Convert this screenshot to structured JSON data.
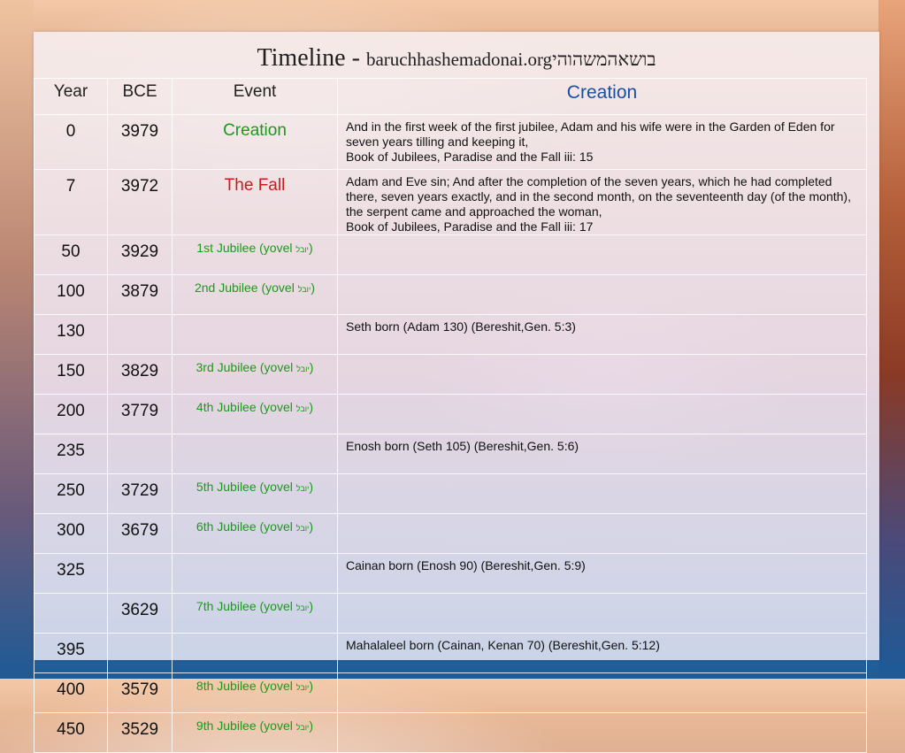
{
  "title": {
    "main": "Timeline - ",
    "site": "baruchhashemadonai.org",
    "hebrew": "בושאהמשהוהי"
  },
  "headers": {
    "year": "Year",
    "bce": "BCE",
    "event": "Event",
    "creation": "Creation"
  },
  "rows": [
    {
      "year": "0",
      "bce": "3979",
      "event": "Creation",
      "note": "And in the first week of the first jubilee, Adam and his wife were in the Garden of Eden for seven years tilling and keeping it,\nBook of Jubilees, Paradise and the Fall iii: 15"
    },
    {
      "year": "7",
      "bce": "3972",
      "event": "The Fall",
      "note": "Adam and Eve sin; And after the completion of the seven years, which he had completed there, seven years exactly, and in the second month, on the seventeenth day (of the month), the serpent came and approached the woman,\nBook of Jubilees, Paradise and the Fall iii: 17"
    },
    {
      "year": "50",
      "bce": "3929",
      "event": "1st Jubilee (yovel ",
      "heb": "יובל",
      "event_end": ")",
      "note": ""
    },
    {
      "year": "100",
      "bce": "3879",
      "event": "2nd Jubilee (yovel ",
      "heb": "יובל",
      "event_end": ")",
      "note": ""
    },
    {
      "year": "130",
      "bce": "",
      "event": "",
      "note": "Seth born (Adam 130) (Bereshit,Gen. 5:3)"
    },
    {
      "year": "150",
      "bce": "3829",
      "event": "3rd Jubilee (yovel ",
      "heb": "יובל",
      "event_end": ")",
      "note": ""
    },
    {
      "year": "200",
      "bce": "3779",
      "event": "4th Jubilee (yovel ",
      "heb": "יובל",
      "event_end": ")",
      "note": ""
    },
    {
      "year": "235",
      "bce": "",
      "event": "",
      "note": "Enosh born (Seth 105) (Bereshit,Gen. 5:6)"
    },
    {
      "year": "250",
      "bce": "3729",
      "event": "5th Jubilee (yovel ",
      "heb": "יובל",
      "event_end": ")",
      "note": ""
    },
    {
      "year": "300",
      "bce": "3679",
      "event": "6th Jubilee (yovel ",
      "heb": "יובל",
      "event_end": ")",
      "note": ""
    },
    {
      "year": "325",
      "bce": "",
      "event": "",
      "note": "Cainan born (Enosh 90) (Bereshit,Gen. 5:9)"
    },
    {
      "year": "",
      "bce": "3629",
      "event": "7th Jubilee (yovel ",
      "heb": "יובל",
      "event_end": ")",
      "note": ""
    },
    {
      "year": "395",
      "bce": "",
      "event": "",
      "note": "Mahalaleel born (Cainan, Kenan 70) (Bereshit,Gen. 5:12)"
    },
    {
      "year": "400",
      "bce": "3579",
      "event": "8th Jubilee (yovel ",
      "heb": "יובל",
      "event_end": ")",
      "note": ""
    },
    {
      "year": "450",
      "bce": "3529",
      "event": "9th Jubilee (yovel ",
      "heb": "יובל",
      "event_end": ")",
      "note": ""
    }
  ],
  "colors": {
    "jubilee_text": "#1a9a1a",
    "fall_text": "#cc1a1a",
    "creation_header": "#1a4fa0"
  }
}
